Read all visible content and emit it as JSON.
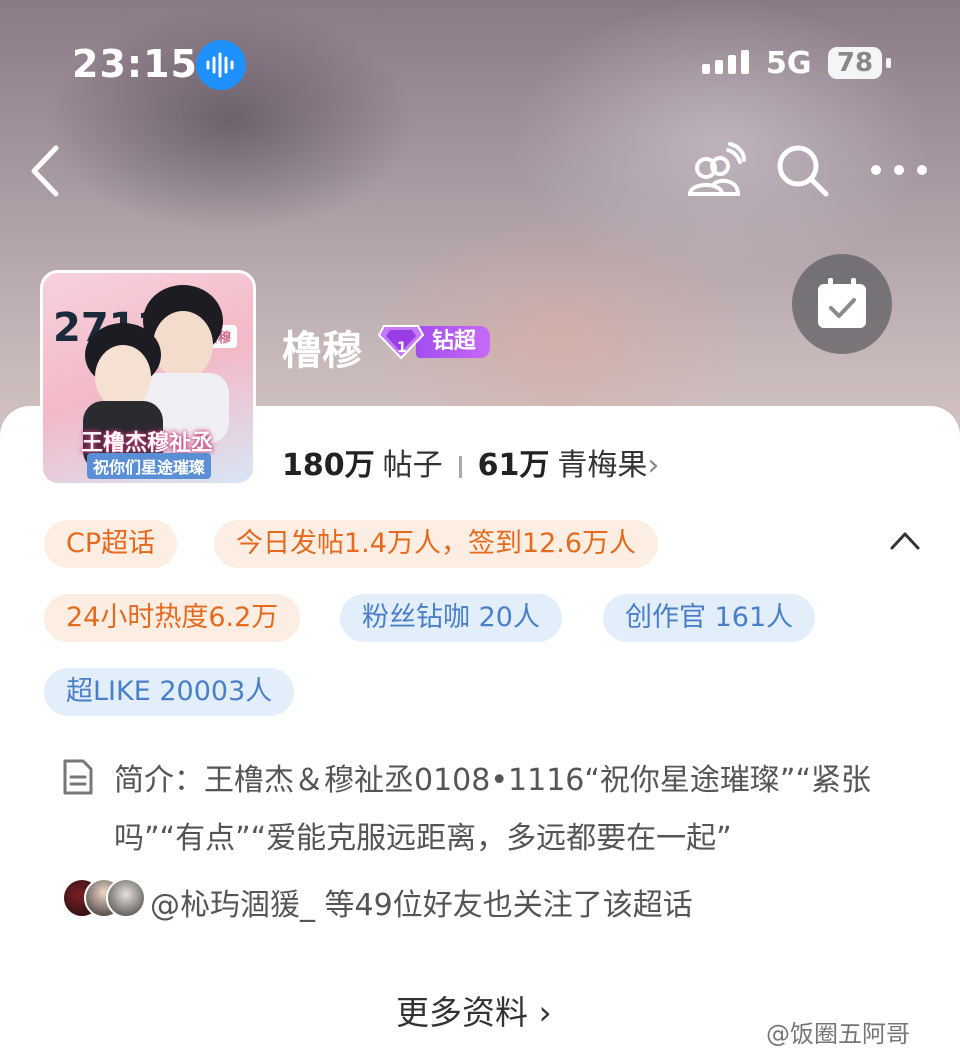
{
  "status_bar": {
    "time": "23:15",
    "network": "5G",
    "battery": "78"
  },
  "topic": {
    "name": "橹穆",
    "badge": "钻超",
    "avatar": {
      "number": "2711",
      "tag": "橹穆",
      "title": "王橹杰穆祉丞",
      "subtitle": "祝你们星途璀璨"
    }
  },
  "stats": {
    "posts_value": "180万",
    "posts_label": "帖子",
    "fans_value": "61万",
    "fans_label": "青梅果",
    "chevron": "›"
  },
  "chips": [
    {
      "label": "CP超话",
      "style": "orange"
    },
    {
      "label": "今日发帖1.4万人，签到12.6万人",
      "style": "orange"
    },
    {
      "label": "24小时热度6.2万",
      "style": "orange"
    },
    {
      "label": "粉丝钻咖 20人",
      "style": "blue"
    },
    {
      "label": "创作官 161人",
      "style": "blue"
    },
    {
      "label": "超LIKE 20003人",
      "style": "blue"
    }
  ],
  "intro": {
    "text": "简介：王橹杰＆穆祉丞0108•1116“祝你星途璀璨”“紧张吗”“有点”“爱能克服远距离，多远都要在一起”"
  },
  "friends": {
    "text": "@杺玙涸猨_ 等49位好友也关注了该超话"
  },
  "more_label": "更多资料 ›",
  "watermark": "@饭圈五阿哥",
  "colors": {
    "chip_orange_bg": "#fdeee4",
    "chip_orange_text": "#e56a1e",
    "chip_blue_bg": "#e3eefb",
    "chip_blue_text": "#4a7fc8",
    "badge_purple": "#b45cf4",
    "voice_blue": "#1e90ff"
  }
}
